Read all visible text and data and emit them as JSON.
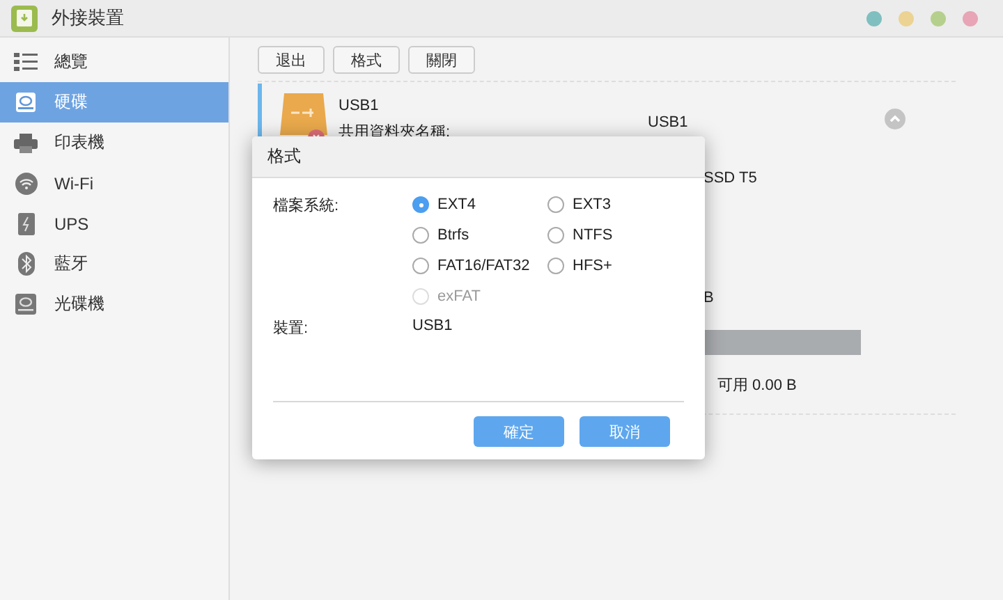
{
  "window": {
    "title": "外接裝置",
    "controls": [
      {
        "color": "#7fbfc0"
      },
      {
        "color": "#ecd393"
      },
      {
        "color": "#b5d08c"
      },
      {
        "color": "#e7a5b6"
      }
    ]
  },
  "sidebar": {
    "items": [
      {
        "label": "總覽",
        "selected": false
      },
      {
        "label": "硬碟",
        "selected": true
      },
      {
        "label": "印表機",
        "selected": false
      },
      {
        "label": "Wi-Fi",
        "selected": false
      },
      {
        "label": "UPS",
        "selected": false
      },
      {
        "label": "藍牙",
        "selected": false
      },
      {
        "label": "光碟機",
        "selected": false
      }
    ]
  },
  "toolbar": {
    "buttons": [
      "退出",
      "格式",
      "關閉"
    ]
  },
  "device": {
    "name": "USB1",
    "share_label": "共用資料夾名稱:",
    "share_value": "USB1",
    "model": "SSD T5",
    "size": "B",
    "usage": {
      "level": 1
    },
    "free": "可用 0.00 B"
  },
  "dialog": {
    "title": "格式",
    "filesystem_label": "檔案系統:",
    "options": [
      {
        "label": "EXT4",
        "selected": true,
        "disabled": false
      },
      {
        "label": "EXT3",
        "selected": false,
        "disabled": false
      },
      {
        "label": "Btrfs",
        "selected": false,
        "disabled": false
      },
      {
        "label": "NTFS",
        "selected": false,
        "disabled": false
      },
      {
        "label": "FAT16/FAT32",
        "selected": false,
        "disabled": false
      },
      {
        "label": "HFS+",
        "selected": false,
        "disabled": false
      },
      {
        "label": "exFAT",
        "selected": false,
        "disabled": true
      }
    ],
    "device_label": "裝置:",
    "device_value": "USB1",
    "buttons": [
      "確定",
      "取消"
    ]
  }
}
